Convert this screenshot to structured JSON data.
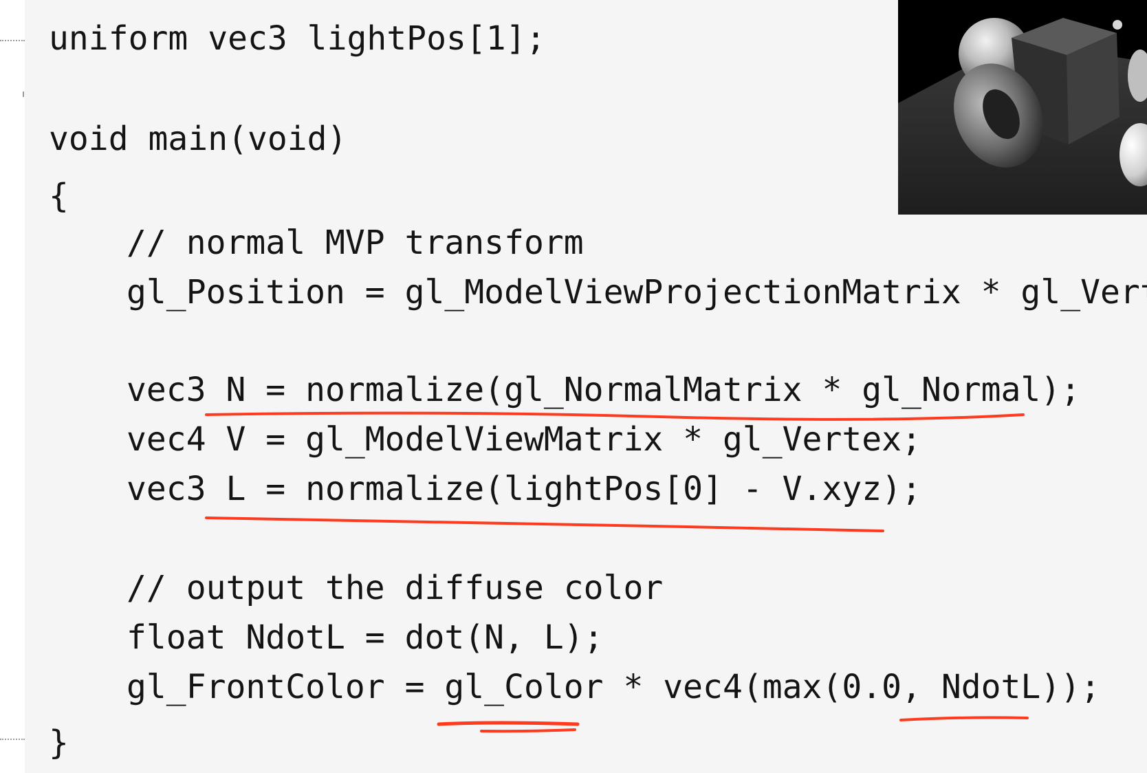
{
  "code": {
    "lines": [
      "uniform vec3 lightPos[1];",
      "void main(void)",
      "{",
      "// normal MVP transform",
      "gl_Position = gl_ModelViewProjectionMatrix * gl_Verte",
      "vec3 N = normalize(gl_NormalMatrix * gl_Normal);",
      "vec4 V = gl_ModelViewMatrix * gl_Vertex;",
      "vec3 L = normalize(lightPos[0] - V.xyz);",
      "// output the diffuse color",
      "float NdotL = dot(N, L);",
      "gl_FrontColor = gl_Color * vec4(max(0.0, NdotL));",
      "}"
    ]
  },
  "colors": {
    "code_text": "#141414",
    "code_background": "#f5f5f5",
    "annotation_underline": "#ff3b1f",
    "render_background": "#000000"
  },
  "render_preview": {
    "objects": [
      "sphere",
      "cube",
      "torus",
      "floor-plane"
    ]
  }
}
